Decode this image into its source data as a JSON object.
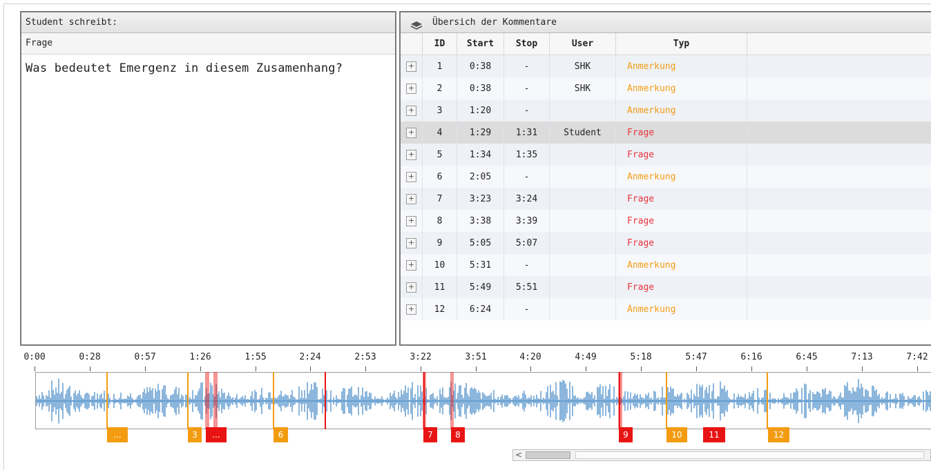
{
  "left": {
    "header": "Student schreibt:",
    "subheader": "Frage",
    "question": "Was bedeutet Emergenz in diesem Zusamenhang?"
  },
  "right": {
    "header": "Übersich der Kommentare",
    "icon": "layers-icon",
    "columns": [
      "ID",
      "Start",
      "Stop",
      "User",
      "Typ"
    ],
    "rows": [
      {
        "id": "1",
        "start": "0:38",
        "stop": "-",
        "user": "SHK",
        "typ": "Anmerkung"
      },
      {
        "id": "2",
        "start": "0:38",
        "stop": "-",
        "user": "SHK",
        "typ": "Anmerkung"
      },
      {
        "id": "3",
        "start": "1:20",
        "stop": "-",
        "user": "",
        "typ": "Anmerkung"
      },
      {
        "id": "4",
        "start": "1:29",
        "stop": "1:31",
        "user": "Student",
        "typ": "Frage"
      },
      {
        "id": "5",
        "start": "1:34",
        "stop": "1:35",
        "user": "",
        "typ": "Frage"
      },
      {
        "id": "6",
        "start": "2:05",
        "stop": "-",
        "user": "",
        "typ": "Anmerkung"
      },
      {
        "id": "7",
        "start": "3:23",
        "stop": "3:24",
        "user": "",
        "typ": "Frage"
      },
      {
        "id": "8",
        "start": "3:38",
        "stop": "3:39",
        "user": "",
        "typ": "Frage"
      },
      {
        "id": "9",
        "start": "5:05",
        "stop": "5:07",
        "user": "",
        "typ": "Frage"
      },
      {
        "id": "10",
        "start": "5:31",
        "stop": "-",
        "user": "",
        "typ": "Anmerkung"
      },
      {
        "id": "11",
        "start": "5:49",
        "stop": "5:51",
        "user": "",
        "typ": "Frage"
      },
      {
        "id": "12",
        "start": "6:24",
        "stop": "-",
        "user": "",
        "typ": "Anmerkung"
      }
    ],
    "selected_row": 4
  },
  "timeline": {
    "ticks": [
      "0:00",
      "0:28",
      "0:57",
      "1:26",
      "1:55",
      "2:24",
      "2:53",
      "3:22",
      "3:51",
      "4:20",
      "4:49",
      "5:18",
      "5:47",
      "6:16",
      "6:45",
      "7:13",
      "7:42"
    ],
    "markers": [
      {
        "label": "...",
        "color": "orange"
      },
      {
        "label": "3",
        "color": "orange"
      },
      {
        "label": "...",
        "color": "red"
      },
      {
        "label": "6",
        "color": "orange"
      },
      {
        "label": "7",
        "color": "red"
      },
      {
        "label": "8",
        "color": "red"
      },
      {
        "label": "9",
        "color": "red"
      },
      {
        "label": "10",
        "color": "orange"
      },
      {
        "label": "11",
        "color": "red"
      },
      {
        "label": "12",
        "color": "orange"
      }
    ],
    "scroll_left_arrow": "<"
  },
  "colors": {
    "anmerkung": "#f39c12",
    "frage": "#e8343f",
    "waveform": "#3f86c4",
    "selected_row": "#dcdcdc"
  }
}
